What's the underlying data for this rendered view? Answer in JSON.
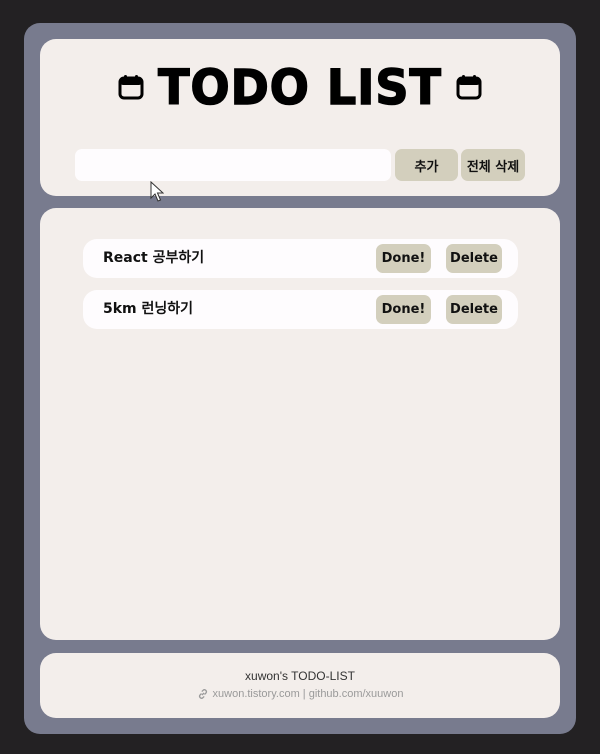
{
  "header": {
    "title": "TODO LIST",
    "input_placeholder": "",
    "add_label": "추가",
    "clear_label": "전체 삭제"
  },
  "todos": [
    {
      "text": "React 공부하기",
      "done_label": "Done!",
      "delete_label": "Delete"
    },
    {
      "text": "5km 런닝하기",
      "done_label": "Done!",
      "delete_label": "Delete"
    }
  ],
  "footer": {
    "title": "xuwon's TODO-LIST",
    "links": "xuwon.tistory.com | github.com/xuuwon"
  },
  "colors": {
    "page_bg": "#232123",
    "frame": "#787b8e",
    "card": "#f3eeeb",
    "button": "#d3cfbd",
    "item": "#fefcfe"
  },
  "icons": [
    "calendar-icon",
    "link-icon",
    "cursor-icon"
  ]
}
